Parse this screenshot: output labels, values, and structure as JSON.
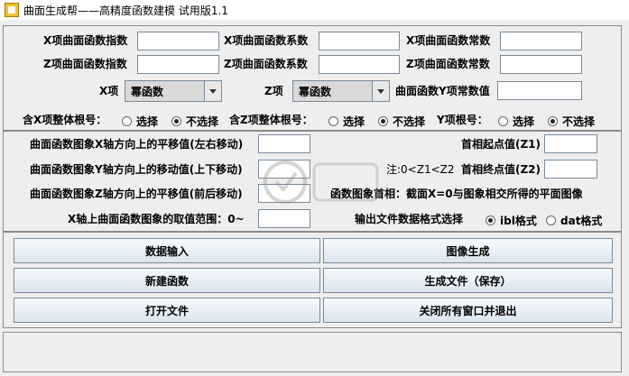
{
  "window": {
    "title": "曲面生成帮——高精度函数建模    试用版1.1"
  },
  "row1": {
    "x_exp_label": "X项曲面函数指数",
    "x_coef_label": "X项曲面函数系数",
    "x_const_label": "X项曲面函数常数"
  },
  "row2": {
    "z_exp_label": "Z项曲面函数指数",
    "z_coef_label": "Z项曲面函数系数",
    "z_const_label": "Z项曲面函数常数"
  },
  "row3": {
    "x_label": "X项",
    "x_type": "幂函数",
    "z_label": "Z项",
    "z_type": "幂函数",
    "y_const_label": "曲面函数Y项常数值"
  },
  "roots": {
    "x_root_label": "含X项整体根号：",
    "z_root_label": "含Z项整体根号：",
    "y_root_label": "Y项根号：",
    "opt_yes": "选择",
    "opt_no": "不选择"
  },
  "params": {
    "x_shift_label": "曲面函数图象X轴方向上的平移值(左右移动)",
    "y_shift_label": "曲面函数图象Y轴方向上的移动值(上下移动)",
    "z_shift_label": "曲面函数图象Z轴方向上的平移值(前后移动)",
    "range_label": "X轴上曲面函数图象的取值范围：0~",
    "phase_start_label": "首相起点值(Z1)",
    "phase_end_label": "首相终点值(Z2)",
    "note": "注:0<Z1<Z2",
    "section_note": "函数图象首相：截面X=0与图象相交所得的平面图像",
    "format_label": "输出文件数据格式选择",
    "fmt_ibl": "ibl格式",
    "fmt_dat": "dat格式"
  },
  "buttons": {
    "data_input": "数据输入",
    "image_gen": "图像生成",
    "new_func": "新建函数",
    "gen_file": "生成文件（保存）",
    "open_file": "打开文件",
    "close_exit": "关闭所有窗口并退出"
  },
  "icons": {
    "app": "app-icon"
  }
}
